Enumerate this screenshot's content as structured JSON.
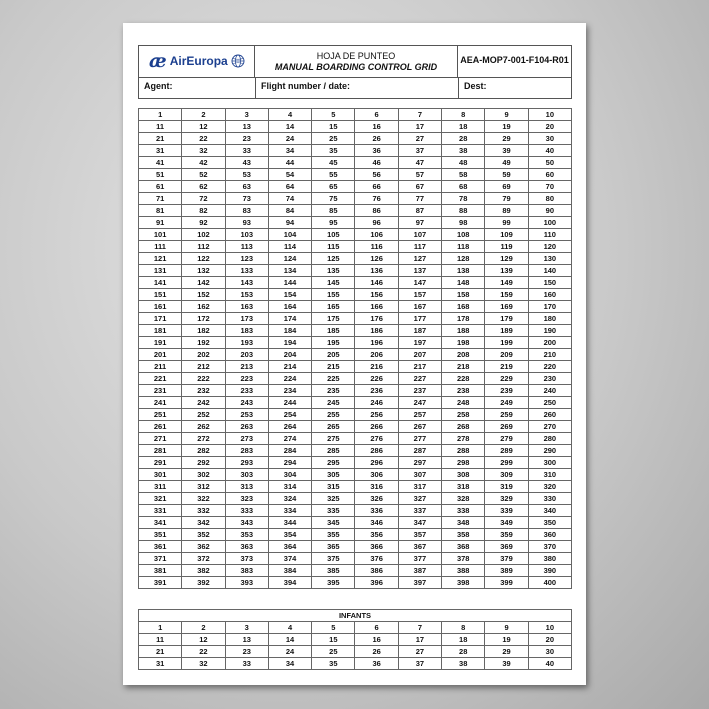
{
  "header": {
    "logo_text": "AirEuropa",
    "logo_mark": "æ",
    "title": "HOJA DE PUNTEO",
    "subtitle": "MANUAL BOARDING CONTROL GRID",
    "form_code": "AEA-MOP7-001-F104-R01",
    "agent_label": "Agent:",
    "flight_label": "Flight number / date:",
    "dest_label": "Dest:",
    "brand_color": "#1b3f8f"
  },
  "passenger_grid": {
    "first": 1,
    "last": 400,
    "columns": 10
  },
  "infants": {
    "label": "INFANTS",
    "first": 1,
    "last": 40,
    "columns": 10
  }
}
